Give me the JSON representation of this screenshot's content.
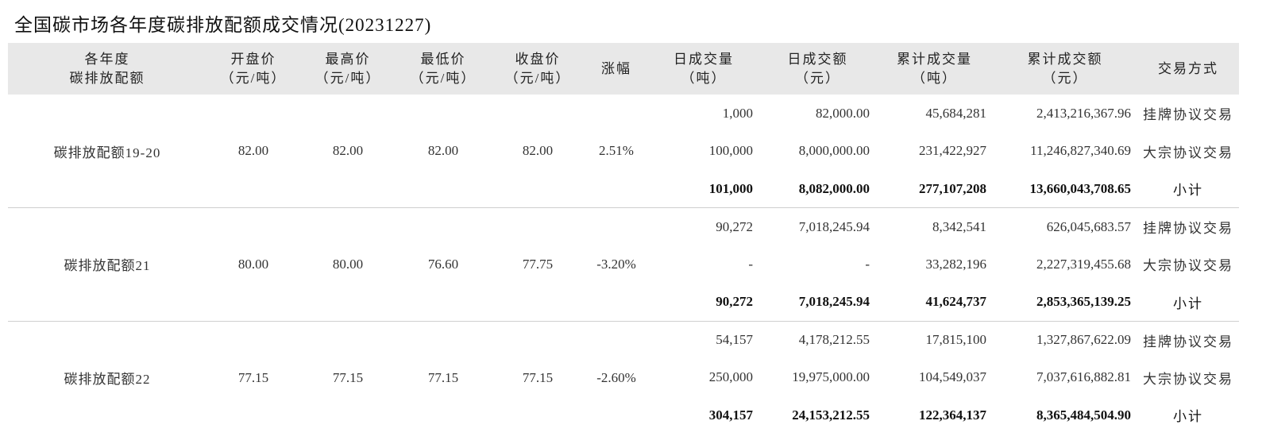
{
  "title": "全国碳市场各年度碳排放配额成交情况(20231227)",
  "headers": [
    [
      "各年度",
      "碳排放配额"
    ],
    [
      "开盘价",
      "（元/吨）"
    ],
    [
      "最高价",
      "（元/吨）"
    ],
    [
      "最低价",
      "（元/吨）"
    ],
    [
      "收盘价",
      "（元/吨）"
    ],
    [
      "涨幅"
    ],
    [
      "日成交量",
      "（吨）"
    ],
    [
      "日成交额",
      "（元）"
    ],
    [
      "累计成交量",
      "（吨）"
    ],
    [
      "累计成交额",
      "（元）"
    ],
    [
      "交易方式"
    ]
  ],
  "groups": [
    {
      "name": "碳排放配额19-20",
      "open": "82.00",
      "high": "82.00",
      "low": "82.00",
      "close": "82.00",
      "change": "2.51%",
      "rows": [
        {
          "daily_vol": "1,000",
          "daily_amt": "82,000.00",
          "cum_vol": "45,684,281",
          "cum_amt": "2,413,216,367.96",
          "method": "挂牌协议交易"
        },
        {
          "daily_vol": "100,000",
          "daily_amt": "8,000,000.00",
          "cum_vol": "231,422,927",
          "cum_amt": "11,246,827,340.69",
          "method": "大宗协议交易"
        },
        {
          "daily_vol": "101,000",
          "daily_amt": "8,082,000.00",
          "cum_vol": "277,107,208",
          "cum_amt": "13,660,043,708.65",
          "method": "小计"
        }
      ]
    },
    {
      "name": "碳排放配额21",
      "open": "80.00",
      "high": "80.00",
      "low": "76.60",
      "close": "77.75",
      "change": "-3.20%",
      "rows": [
        {
          "daily_vol": "90,272",
          "daily_amt": "7,018,245.94",
          "cum_vol": "8,342,541",
          "cum_amt": "626,045,683.57",
          "method": "挂牌协议交易"
        },
        {
          "daily_vol": "-",
          "daily_amt": "-",
          "cum_vol": "33,282,196",
          "cum_amt": "2,227,319,455.68",
          "method": "大宗协议交易"
        },
        {
          "daily_vol": "90,272",
          "daily_amt": "7,018,245.94",
          "cum_vol": "41,624,737",
          "cum_amt": "2,853,365,139.25",
          "method": "小计"
        }
      ]
    },
    {
      "name": "碳排放配额22",
      "open": "77.15",
      "high": "77.15",
      "low": "77.15",
      "close": "77.15",
      "change": "-2.60%",
      "rows": [
        {
          "daily_vol": "54,157",
          "daily_amt": "4,178,212.55",
          "cum_vol": "17,815,100",
          "cum_amt": "1,327,867,622.09",
          "method": "挂牌协议交易"
        },
        {
          "daily_vol": "250,000",
          "daily_amt": "19,975,000.00",
          "cum_vol": "104,549,037",
          "cum_amt": "7,037,616,882.81",
          "method": "大宗协议交易"
        },
        {
          "daily_vol": "304,157",
          "daily_amt": "24,153,212.55",
          "cum_vol": "122,364,137",
          "cum_amt": "8,365,484,504.90",
          "method": "小计"
        }
      ]
    }
  ]
}
